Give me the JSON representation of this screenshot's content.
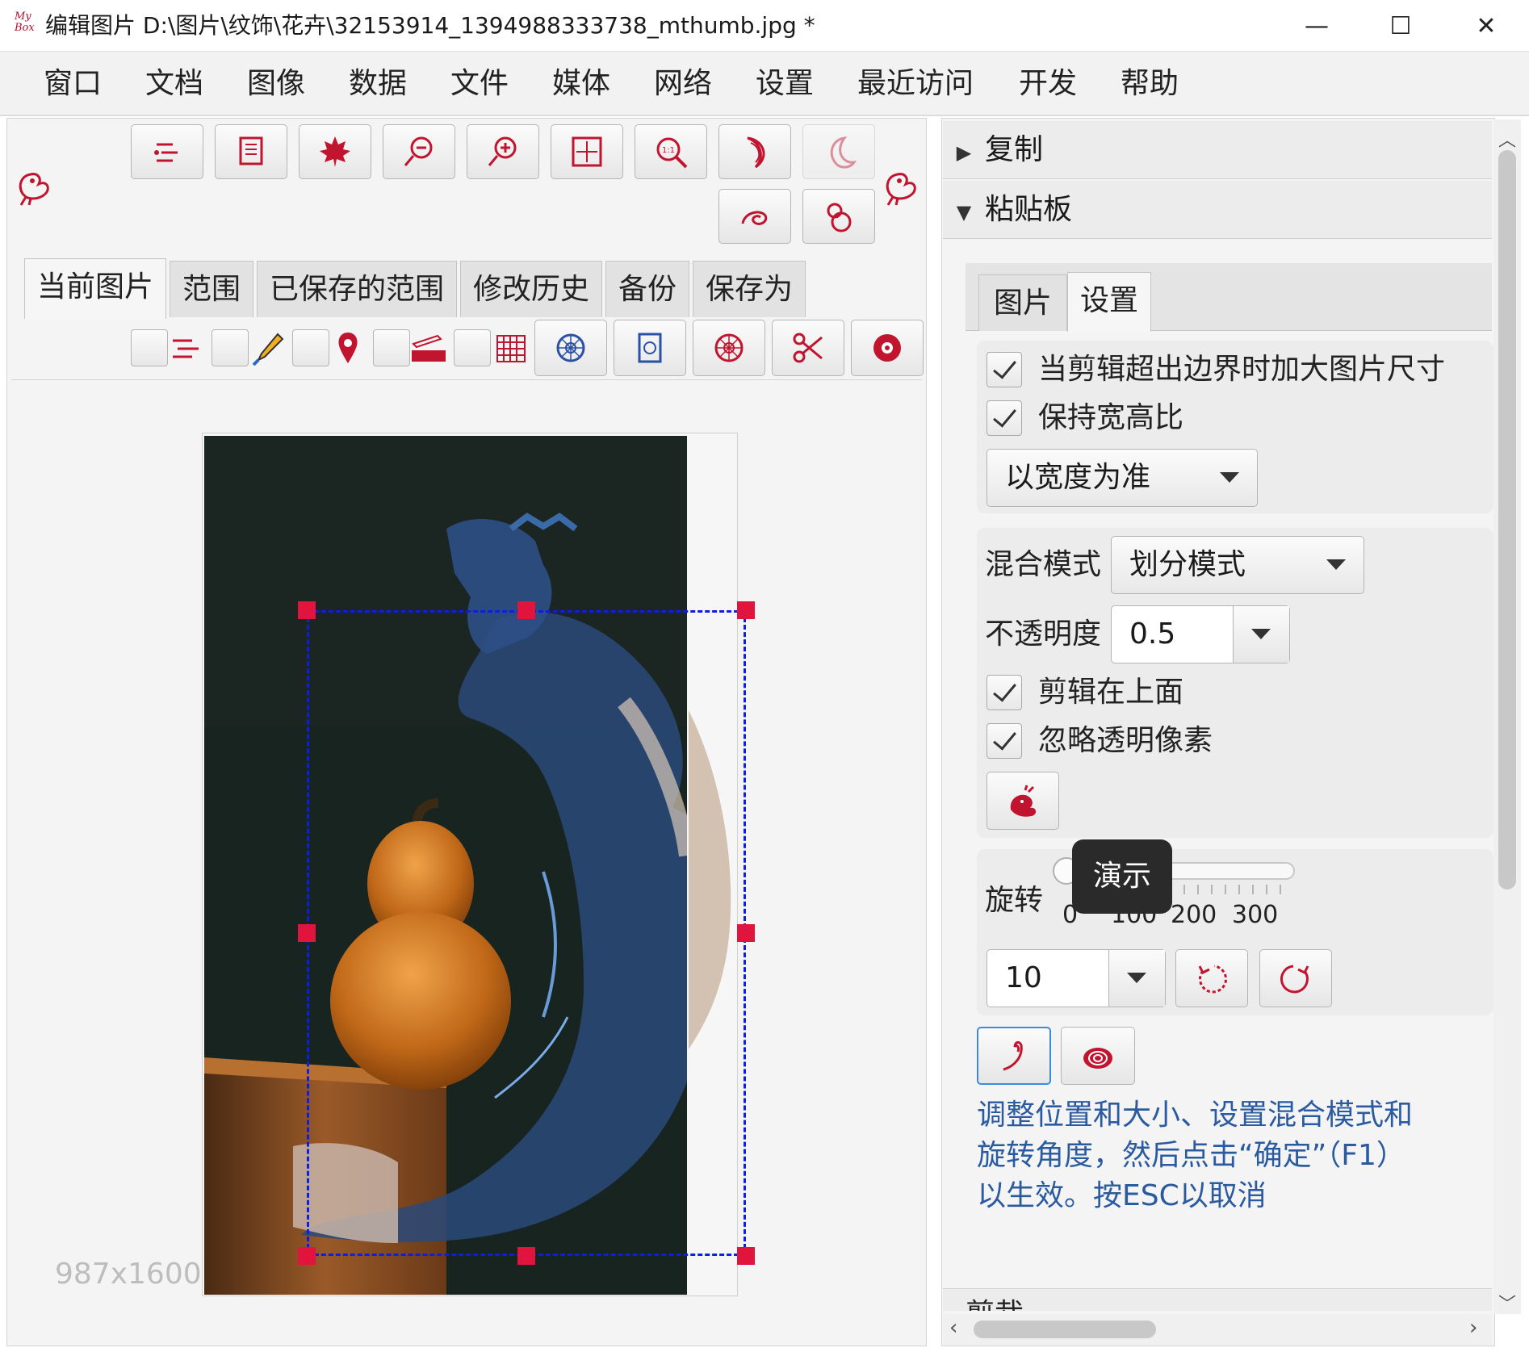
{
  "window": {
    "title": "编辑图片 D:\\图片\\纹饰\\花卉\\32153914_1394988333738_mthumb.jpg  *",
    "logo_text": "My Box",
    "minimize": "—",
    "maximize": "☐",
    "close": "✕"
  },
  "menu": [
    "窗口",
    "文档",
    "图像",
    "数据",
    "文件",
    "媒体",
    "网络",
    "设置",
    "最近访问",
    "开发",
    "帮助"
  ],
  "tabs": [
    "当前图片",
    "范围",
    "已保存的范围",
    "修改历史",
    "备份",
    "保存为"
  ],
  "image_info": {
    "dimensions": "987x1600"
  },
  "right": {
    "sections": {
      "copy": "复制",
      "clipboard": "粘贴板",
      "cut_bottom": "剪裁"
    },
    "sub_tabs": [
      "图片",
      "设置"
    ],
    "options": {
      "enlarge": "当剪辑超出边界时加大图片尺寸",
      "keep_ratio": "保持宽高比",
      "ratio_base": "以宽度为准",
      "blend_label": "混合模式",
      "blend_value": "划分模式",
      "opacity_label": "不透明度",
      "opacity_value": "0.5",
      "on_top": "剪辑在上面",
      "ignore_transparent": "忽略透明像素"
    },
    "tooltip": "演示",
    "rotate": {
      "label": "旋转",
      "ticks": [
        "0",
        "100",
        "200",
        "300"
      ],
      "value": "10"
    },
    "hint": [
      "调整位置和大小、设置混合模式和",
      "旋转角度，然后点击“确定”（F1）",
      "以生效。按ESC以取消"
    ]
  },
  "colors": {
    "accent": "#c0142f",
    "selection": "#0a1ee6",
    "handle": "#e0143c",
    "hint_text": "#2a5aa0"
  }
}
